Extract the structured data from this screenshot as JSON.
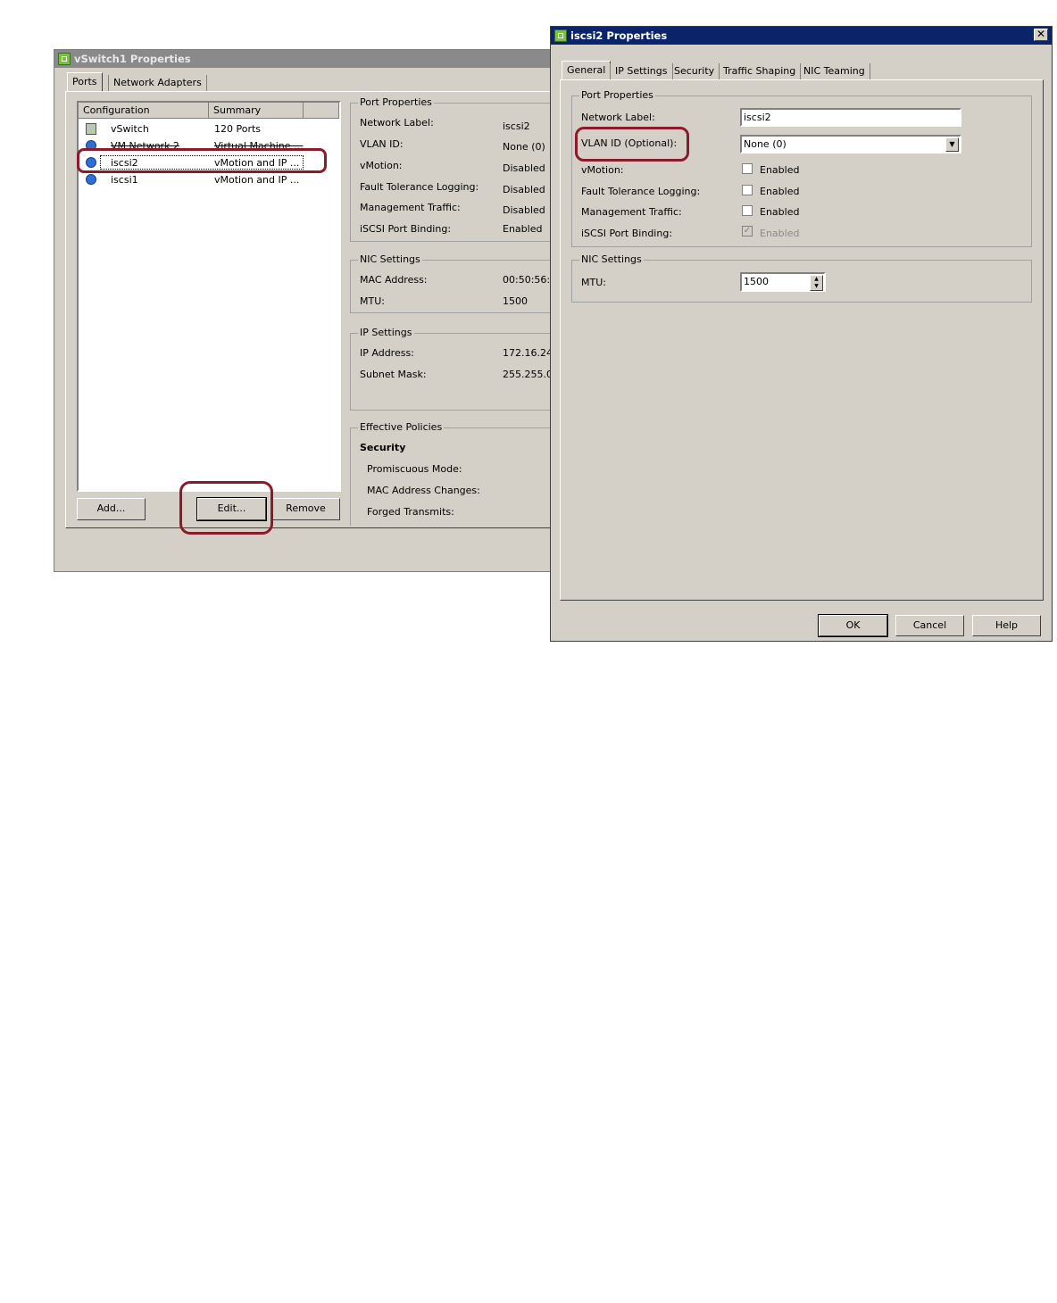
{
  "vswitch_window": {
    "title": "vSwitch1 Properties",
    "tabs": [
      "Ports",
      "Network Adapters"
    ],
    "list_headers": [
      "Configuration",
      "Summary"
    ],
    "rows": [
      {
        "config": "vSwitch",
        "summary": "120 Ports",
        "icon": "switch-icon"
      },
      {
        "config": "VM Network 2",
        "summary": "Virtual Machine ...",
        "icon": "network-icon"
      },
      {
        "config": "iscsi2",
        "summary": "vMotion and IP ...",
        "icon": "network-icon"
      },
      {
        "config": "iscsi1",
        "summary": "vMotion and IP ...",
        "icon": "network-icon"
      }
    ],
    "buttons": {
      "add": "Add...",
      "edit": "Edit...",
      "remove": "Remove"
    },
    "port_properties": {
      "legend": "Port Properties",
      "items": [
        {
          "label": "Network Label:",
          "value": "iscsi2"
        },
        {
          "label": "VLAN ID:",
          "value": "None (0)"
        },
        {
          "label": "vMotion:",
          "value": "Disabled"
        },
        {
          "label": "Fault Tolerance Logging:",
          "value": "Disabled"
        },
        {
          "label": "Management Traffic:",
          "value": "Disabled"
        },
        {
          "label": "iSCSI Port Binding:",
          "value": "Enabled"
        }
      ]
    },
    "nic_settings": {
      "legend": "NIC Settings",
      "items": [
        {
          "label": "MAC Address:",
          "value": "00:50:56:("
        },
        {
          "label": "MTU:",
          "value": "1500"
        }
      ]
    },
    "ip_settings": {
      "legend": "IP Settings",
      "items": [
        {
          "label": "IP Address:",
          "value": "172.16.24"
        },
        {
          "label": "Subnet Mask:",
          "value": "255.255.0"
        }
      ]
    },
    "effective_policies": {
      "legend": "Effective Policies",
      "section": "Security",
      "items": [
        "Promiscuous Mode:",
        "MAC Address Changes:",
        "Forged Transmits:"
      ]
    }
  },
  "iscsi_dialog": {
    "title": "iscsi2 Properties",
    "close_glyph": "✕",
    "tabs": [
      "General",
      "IP Settings",
      "Security",
      "Traffic Shaping",
      "NIC Teaming"
    ],
    "port_properties": {
      "legend": "Port Properties",
      "network_label": {
        "label": "Network Label:",
        "value": "iscsi2"
      },
      "vlan_id": {
        "label": "VLAN ID (Optional):",
        "value": "None (0)"
      },
      "vmotion": {
        "label": "vMotion:",
        "check_label": "Enabled",
        "checked": false
      },
      "ft_logging": {
        "label": "Fault Tolerance Logging:",
        "check_label": "Enabled",
        "checked": false
      },
      "mgmt_traffic": {
        "label": "Management Traffic:",
        "check_label": "Enabled",
        "checked": false
      },
      "iscsi_binding": {
        "label": "iSCSI Port Binding:",
        "check_label": "Enabled",
        "checked": true,
        "disabled": true
      }
    },
    "nic_settings": {
      "legend": "NIC Settings",
      "mtu": {
        "label": "MTU:",
        "value": "1500"
      }
    },
    "buttons": {
      "ok": "OK",
      "cancel": "Cancel",
      "help": "Help"
    }
  },
  "colors": {
    "highlight": "#8b1a2a",
    "active_title": "#0a246a",
    "inactive_title": "#8a8a8a"
  }
}
